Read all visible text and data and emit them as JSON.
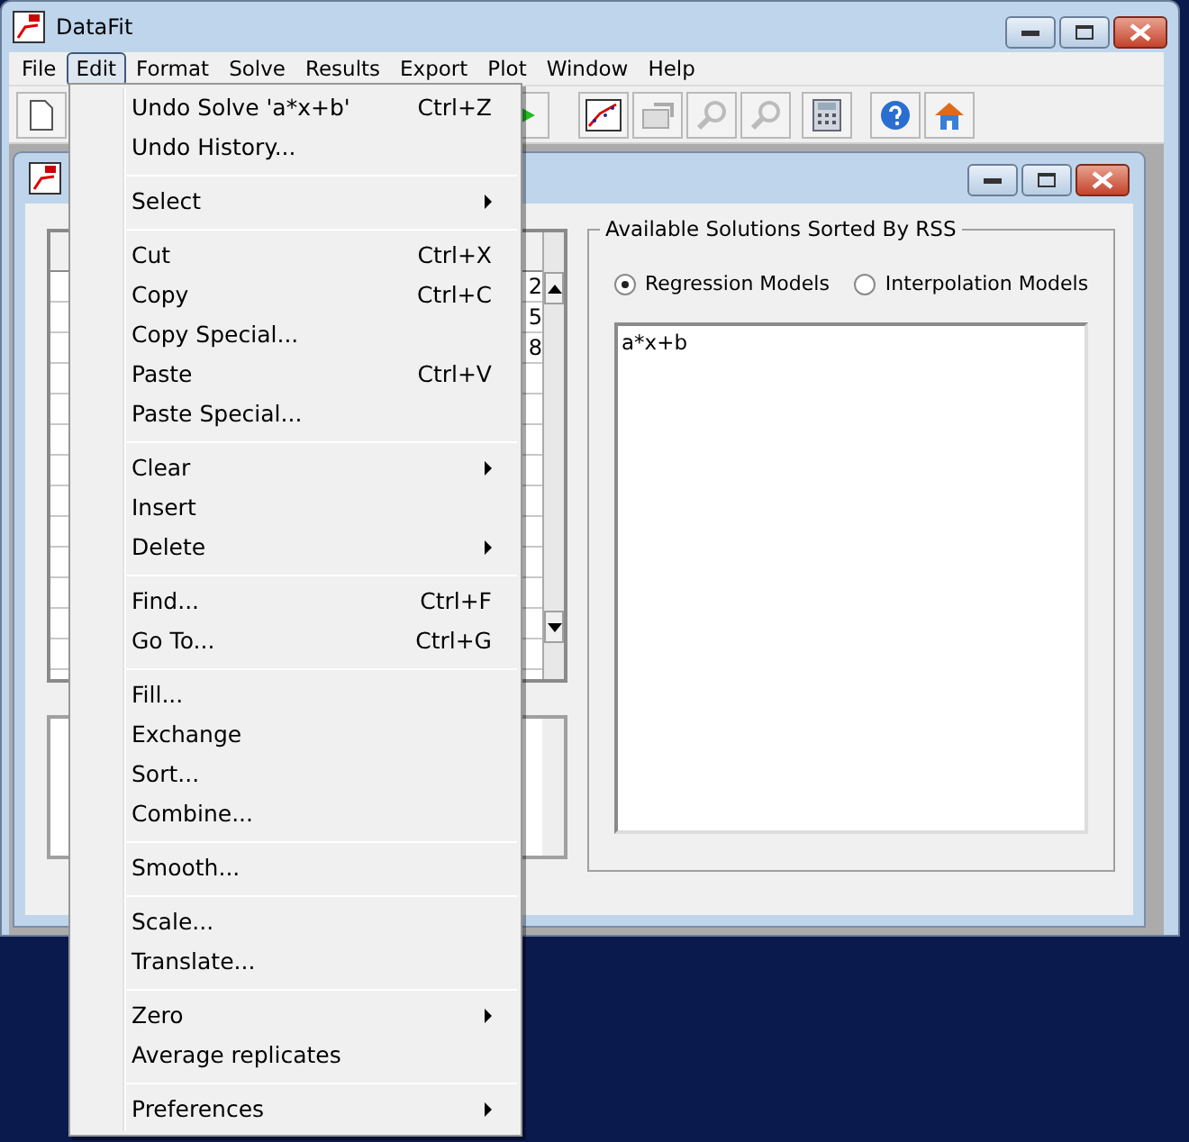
{
  "window": {
    "title": "DataFit"
  },
  "menu_bar": [
    {
      "label": "File",
      "selected": false
    },
    {
      "label": "Edit",
      "selected": true
    },
    {
      "label": "Format",
      "selected": false
    },
    {
      "label": "Solve",
      "selected": false
    },
    {
      "label": "Results",
      "selected": false
    },
    {
      "label": "Export",
      "selected": false
    },
    {
      "label": "Plot",
      "selected": false
    },
    {
      "label": "Window",
      "selected": false
    },
    {
      "label": "Help",
      "selected": false
    }
  ],
  "child_window": {
    "grid": {
      "cells": [
        "2",
        "5",
        "8"
      ]
    },
    "solutions_group": {
      "title": "Available Solutions Sorted By RSS",
      "options": [
        {
          "label": "Regression Models",
          "selected": true
        },
        {
          "label": "Interpolation Models",
          "selected": false
        }
      ],
      "list_items": [
        "a*x+b"
      ]
    }
  },
  "edit_menu": {
    "items": [
      {
        "kind": "item",
        "label": "Undo Solve 'a*x+b'",
        "shortcut": "Ctrl+Z"
      },
      {
        "kind": "item",
        "label": "Undo History..."
      },
      {
        "kind": "separator"
      },
      {
        "kind": "submenu",
        "label": "Select"
      },
      {
        "kind": "separator"
      },
      {
        "kind": "item",
        "label": "Cut",
        "shortcut": "Ctrl+X"
      },
      {
        "kind": "item",
        "label": "Copy",
        "shortcut": "Ctrl+C"
      },
      {
        "kind": "item",
        "label": "Copy Special..."
      },
      {
        "kind": "item",
        "label": "Paste",
        "shortcut": "Ctrl+V"
      },
      {
        "kind": "item",
        "label": "Paste Special..."
      },
      {
        "kind": "separator"
      },
      {
        "kind": "submenu",
        "label": "Clear"
      },
      {
        "kind": "item",
        "label": "Insert"
      },
      {
        "kind": "submenu",
        "label": "Delete"
      },
      {
        "kind": "separator"
      },
      {
        "kind": "item",
        "label": "Find...",
        "shortcut": "Ctrl+F"
      },
      {
        "kind": "item",
        "label": "Go To...",
        "shortcut": "Ctrl+G"
      },
      {
        "kind": "separator"
      },
      {
        "kind": "item",
        "label": "Fill..."
      },
      {
        "kind": "item",
        "label": "Exchange"
      },
      {
        "kind": "item",
        "label": "Sort..."
      },
      {
        "kind": "item",
        "label": "Combine..."
      },
      {
        "kind": "separator"
      },
      {
        "kind": "item",
        "label": "Smooth..."
      },
      {
        "kind": "separator"
      },
      {
        "kind": "item",
        "label": "Scale..."
      },
      {
        "kind": "item",
        "label": "Translate..."
      },
      {
        "kind": "separator"
      },
      {
        "kind": "submenu",
        "label": "Zero"
      },
      {
        "kind": "item",
        "label": "Average replicates"
      },
      {
        "kind": "separator"
      },
      {
        "kind": "submenu",
        "label": "Preferences"
      }
    ]
  }
}
